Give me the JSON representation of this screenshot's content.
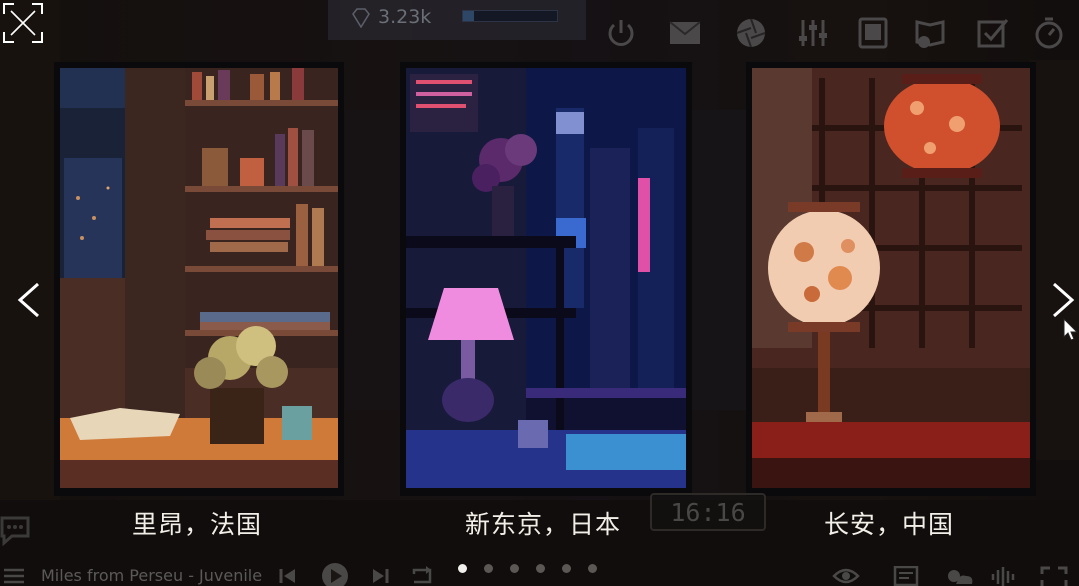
{
  "hud": {
    "gems_count": "3.23k",
    "progress_fraction": 0.12
  },
  "top_icons": [
    "power-icon",
    "mail-icon",
    "camera-aperture-icon",
    "equalizer-icon",
    "tablet-icon",
    "book-settings-icon",
    "checklist-icon",
    "stopwatch-icon"
  ],
  "carousel": {
    "cards": [
      {
        "label": "里昂，法国",
        "theme": "cozy-library"
      },
      {
        "label": "新东京，日本",
        "theme": "neon-city-night"
      },
      {
        "label": "长安，中国",
        "theme": "lantern-room"
      }
    ],
    "page_count": 6,
    "active_page": 1
  },
  "clock": {
    "time": "16:16"
  },
  "player": {
    "track": "Miles from Perseu - Juvenile"
  },
  "colors": {
    "accent": "#f2f0ec",
    "neon_pink": "#e050a8",
    "lantern_red": "#d0502e",
    "night_blue": "#2a3a8a"
  }
}
